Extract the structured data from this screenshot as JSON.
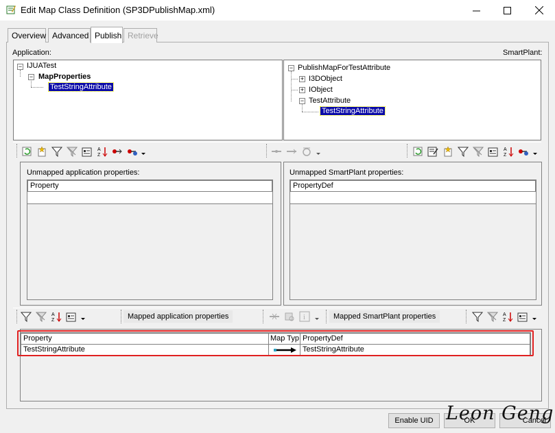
{
  "window": {
    "title": "Edit Map Class Definition (SP3DPublishMap.xml)",
    "controls": [
      "minimize-icon",
      "maximize-icon",
      "close-icon"
    ]
  },
  "tabs": [
    {
      "label": "Overview",
      "state": "normal"
    },
    {
      "label": "Advanced",
      "state": "normal"
    },
    {
      "label": "Publish",
      "state": "active"
    },
    {
      "label": "Retrieve",
      "state": "disabled"
    }
  ],
  "application_label": "Application:",
  "smartplant_label": "SmartPlant:",
  "app_tree": {
    "root": "IJUATest",
    "child": "MapProperties",
    "leaf": "TestStringAttribute"
  },
  "sp_tree": {
    "root": "PublishMapForTestAttribute",
    "items": [
      "I3DObject",
      "IObject",
      "TestAttribute"
    ],
    "leaf": "TestStringAttribute"
  },
  "unmapped_app": {
    "label": "Unmapped application properties:",
    "column": "Property"
  },
  "unmapped_sp": {
    "label": "Unmapped SmartPlant properties:",
    "column": "PropertyDef"
  },
  "mapped_app_caption": "Mapped application properties",
  "mapped_sp_caption": "Mapped SmartPlant properties",
  "mapped_grid": {
    "columns": [
      "Property",
      "Map Typ",
      "PropertyDef"
    ],
    "rows": [
      {
        "property": "TestStringAttribute",
        "map_type_icon": "arrow-right-icon",
        "propertydef": "TestStringAttribute"
      }
    ]
  },
  "buttons": {
    "enable_uid": "Enable UID",
    "ok": "OK",
    "cancel": "Cancel"
  },
  "watermark": "Leon Geng",
  "colors": {
    "selection": "#0a0aa8",
    "highlight_border": "#e02020"
  }
}
